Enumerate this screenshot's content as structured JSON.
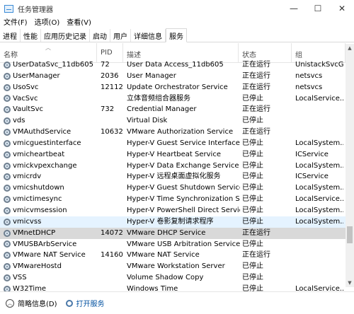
{
  "window": {
    "title": "任务管理器",
    "controls": [
      "—",
      "☐",
      "✕"
    ]
  },
  "menu": [
    "文件(F)",
    "选项(O)",
    "查看(V)"
  ],
  "tabs": [
    "进程",
    "性能",
    "应用历史记录",
    "启动",
    "用户",
    "详细信息",
    "服务"
  ],
  "active_tab_index": 6,
  "columns": {
    "name": "名称",
    "pid": "PID",
    "desc": "描述",
    "status": "状态",
    "group": "组"
  },
  "rows": [
    {
      "name": "UserDataSvc_11db605",
      "pid": "72",
      "desc": "User Data Access_11db605",
      "status": "正在运行",
      "group": "UnistackSvcG..."
    },
    {
      "name": "UserManager",
      "pid": "2036",
      "desc": "User Manager",
      "status": "正在运行",
      "group": "netsvcs"
    },
    {
      "name": "UsoSvc",
      "pid": "12112",
      "desc": "Update Orchestrator Service",
      "status": "正在运行",
      "group": "netsvcs"
    },
    {
      "name": "VacSvc",
      "pid": "",
      "desc": "立体音频组合器服务",
      "status": "已停止",
      "group": "LocalService..."
    },
    {
      "name": "VaultSvc",
      "pid": "732",
      "desc": "Credential Manager",
      "status": "正在运行",
      "group": ""
    },
    {
      "name": "vds",
      "pid": "",
      "desc": "Virtual Disk",
      "status": "已停止",
      "group": ""
    },
    {
      "name": "VMAuthdService",
      "pid": "10632",
      "desc": "VMware Authorization Service",
      "status": "正在运行",
      "group": ""
    },
    {
      "name": "vmicguestinterface",
      "pid": "",
      "desc": "Hyper-V Guest Service Interface",
      "status": "已停止",
      "group": "LocalSystem..."
    },
    {
      "name": "vmicheartbeat",
      "pid": "",
      "desc": "Hyper-V Heartbeat Service",
      "status": "已停止",
      "group": "ICService"
    },
    {
      "name": "vmickvpexchange",
      "pid": "",
      "desc": "Hyper-V Data Exchange Service",
      "status": "已停止",
      "group": "LocalSystem..."
    },
    {
      "name": "vmicrdv",
      "pid": "",
      "desc": "Hyper-V 远程桌面虚拟化服务",
      "status": "已停止",
      "group": "ICService"
    },
    {
      "name": "vmicshutdown",
      "pid": "",
      "desc": "Hyper-V Guest Shutdown Service",
      "status": "已停止",
      "group": "LocalSystem..."
    },
    {
      "name": "vmictimesync",
      "pid": "",
      "desc": "Hyper-V Time Synchronization Se...",
      "status": "已停止",
      "group": "LocalService..."
    },
    {
      "name": "vmicvmsession",
      "pid": "",
      "desc": "Hyper-V PowerShell Direct Service",
      "status": "已停止",
      "group": "LocalSystem..."
    },
    {
      "name": "vmicvss",
      "pid": "",
      "desc": "Hyper-V 卷影复制请求程序",
      "status": "已停止",
      "group": "LocalSystem..."
    },
    {
      "name": "VMnetDHCP",
      "pid": "14072",
      "desc": "VMware DHCP Service",
      "status": "正在运行",
      "group": ""
    },
    {
      "name": "VMUSBArbService",
      "pid": "",
      "desc": "VMware USB Arbitration Service",
      "status": "已停止",
      "group": ""
    },
    {
      "name": "VMware NAT Service",
      "pid": "14160",
      "desc": "VMware NAT Service",
      "status": "正在运行",
      "group": ""
    },
    {
      "name": "VMwareHostd",
      "pid": "",
      "desc": "VMware Workstation Server",
      "status": "已停止",
      "group": ""
    },
    {
      "name": "VSS",
      "pid": "",
      "desc": "Volume Shadow Copy",
      "status": "已停止",
      "group": ""
    },
    {
      "name": "W32Time",
      "pid": "",
      "desc": "Windows Time",
      "status": "已停止",
      "group": "LocalService..."
    }
  ],
  "hover_row_index": 14,
  "selected_row_index": 15,
  "footer": {
    "fold_label": "简略信息(D)",
    "open_services_label": "打开服务"
  },
  "colors": {
    "hover": "#e5f3ff",
    "selected": "#d9d9d9",
    "link": "#0050a0"
  },
  "icons": {
    "app": "task-manager-icon",
    "service": "service-gear-icon",
    "fold": "chevron-up-circle-icon",
    "open_services": "services-icon"
  }
}
